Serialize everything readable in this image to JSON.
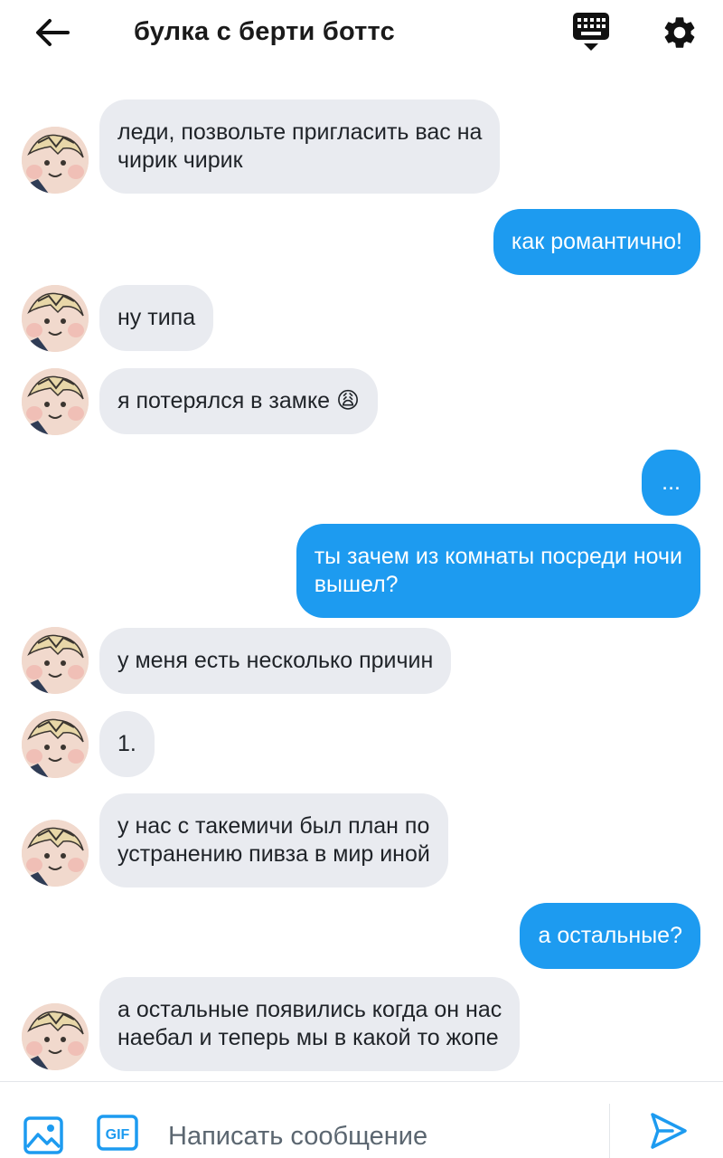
{
  "header": {
    "title": "булка с берти боттс",
    "back_icon": "arrow-left-icon",
    "keyboard_icon": "keyboard-icon",
    "settings_icon": "gear-icon"
  },
  "messages": [
    {
      "dir": "in",
      "text": "леди, позвольте пригласить вас на\nчирик чирик"
    },
    {
      "dir": "out",
      "text": "как романтично!"
    },
    {
      "dir": "in",
      "text": "ну типа"
    },
    {
      "dir": "in",
      "text": "я потерялся в замке 😩"
    },
    {
      "dir": "out",
      "text": "..."
    },
    {
      "dir": "out",
      "text": "ты зачем из комнаты посреди ночи\nвышел?"
    },
    {
      "dir": "in",
      "text": "у меня есть несколько причин"
    },
    {
      "dir": "in",
      "text": "1."
    },
    {
      "dir": "in",
      "text": "у нас с такемичи был план по\nустранению пивза в мир иной"
    },
    {
      "dir": "out",
      "text": "а остальные?"
    },
    {
      "dir": "in",
      "text": "а остальные появились когда он нас\nнаебал и теперь мы в какой то жопе"
    }
  ],
  "composer": {
    "placeholder": "Написать сообщение",
    "gif_label": "GIF",
    "media_icon": "image-icon",
    "send_icon": "send-icon"
  },
  "colors": {
    "incoming_bubble": "#e9ebf0",
    "outgoing_bubble": "#1d9bf0",
    "accent": "#1d9bf0"
  }
}
